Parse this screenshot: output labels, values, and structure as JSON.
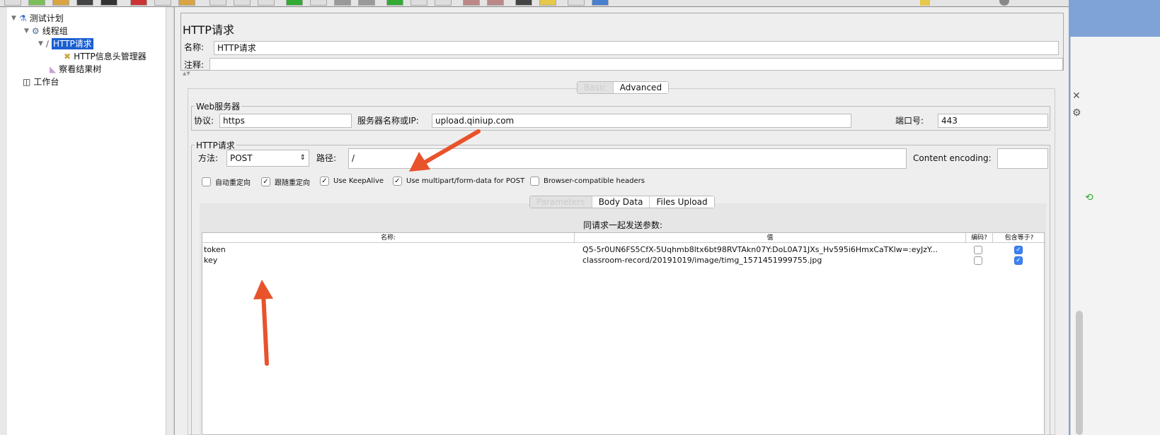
{
  "tree": {
    "items": [
      {
        "label": "测试计划",
        "icon": "flask-icon"
      },
      {
        "label": "线程组",
        "icon": "gear-icon"
      },
      {
        "label": "HTTP请求",
        "icon": "pipette-icon",
        "selected": true
      },
      {
        "label": "HTTP信息头管理器",
        "icon": "wrench-icon"
      },
      {
        "label": "察看结果树",
        "icon": "chart-icon"
      },
      {
        "label": "工作台",
        "icon": "workbench-icon"
      }
    ]
  },
  "panel": {
    "title": "HTTP请求",
    "name_label": "名称:",
    "name_value": "HTTP请求",
    "comment_label": "注释:",
    "comment_value": ""
  },
  "mode_tabs": [
    "Basic",
    "Advanced"
  ],
  "web_server": {
    "legend": "Web服务器",
    "protocol_label": "协议:",
    "protocol": "https",
    "server_label": "服务器名称或IP:",
    "server": "upload.qiniup.com",
    "port_label": "端口号:",
    "port": "443"
  },
  "http_request": {
    "legend": "HTTP请求",
    "method_label": "方法:",
    "method": "POST",
    "path_label": "路径:",
    "path": "/",
    "encoding_label": "Content encoding:",
    "encoding": ""
  },
  "options": [
    {
      "label": "自动重定向",
      "checked": false
    },
    {
      "label": "跟随重定向",
      "checked": true
    },
    {
      "label": "Use KeepAlive",
      "checked": true
    },
    {
      "label": "Use multipart/form-data for POST",
      "checked": true
    },
    {
      "label": "Browser-compatible headers",
      "checked": false
    }
  ],
  "param_tabs": [
    "Parameters",
    "Body Data",
    "Files Upload"
  ],
  "params": {
    "title": "同请求一起发送参数:",
    "columns": [
      "名称:",
      "值",
      "编码?",
      "包含等于?"
    ],
    "rows": [
      {
        "name": "token",
        "value": "Q5-5r0UN6FS5CfX-5Uqhmb8ltx6bt98RVTAkn07Y:DoL0A71JXs_Hv595i6HmxCaTKlw=:eyJzY...",
        "encode": false,
        "include_equals": true
      },
      {
        "name": "key",
        "value": "classroom-record/20191019/image/timg_1571451999755.jpg",
        "encode": false,
        "include_equals": true
      }
    ]
  },
  "colors": {
    "selection": "#1b5fd1",
    "arrow": "#e8532b",
    "checkbox_on": "#3b82f6"
  }
}
